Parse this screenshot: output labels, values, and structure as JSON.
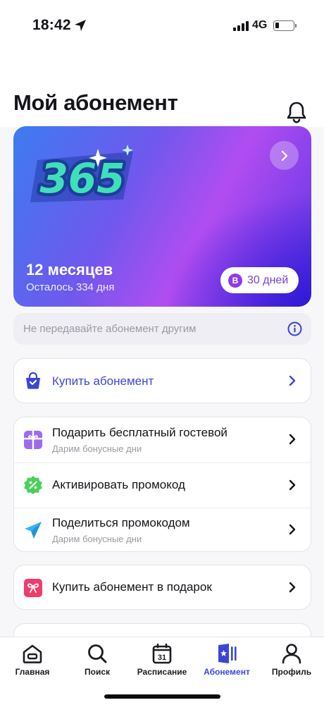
{
  "status_bar": {
    "time": "18:42",
    "network": "4G"
  },
  "header": {
    "title": "Мой абонемент"
  },
  "subscription_card": {
    "logo_text": "365",
    "title": "12 месяцев",
    "remaining": "Осталось 334 дня",
    "bonus_badge": "B",
    "bonus_days": "30 дней",
    "colors": {
      "gradient_start": "#3d7bf0",
      "gradient_mid": "#b14df0",
      "gradient_end": "#2e1ed6"
    }
  },
  "notice": {
    "text": "Не передавайте абонемент другим",
    "icon": "info-icon"
  },
  "groups": [
    {
      "items": [
        {
          "icon": "shopping-bag-icon",
          "title": "Купить абонемент",
          "subtitle": ""
        }
      ]
    },
    {
      "items": [
        {
          "icon": "gift-icon",
          "title": "Подарить бесплатный гостевой",
          "subtitle": "Дарим бонусные дни"
        },
        {
          "icon": "percent-badge-icon",
          "title": "Активировать промокод",
          "subtitle": ""
        },
        {
          "icon": "paper-plane-icon",
          "title": "Поделиться промокодом",
          "subtitle": "Дарим бонусные дни"
        }
      ]
    },
    {
      "items": [
        {
          "icon": "gift-box-icon",
          "title": "Купить абонемент в подарок",
          "subtitle": ""
        }
      ]
    }
  ],
  "tabbar": {
    "items": [
      {
        "label": "Главная",
        "icon": "home-icon",
        "active": false
      },
      {
        "label": "Поиск",
        "icon": "search-icon",
        "active": false
      },
      {
        "label": "Расписание",
        "icon": "calendar-icon",
        "active": false,
        "icon_text": "31"
      },
      {
        "label": "Абонемент",
        "icon": "membership-card-icon",
        "active": true
      },
      {
        "label": "Профиль",
        "icon": "profile-icon",
        "active": false
      }
    ]
  },
  "colors": {
    "accent": "#3b46d6",
    "background": "#f7f7f9"
  }
}
